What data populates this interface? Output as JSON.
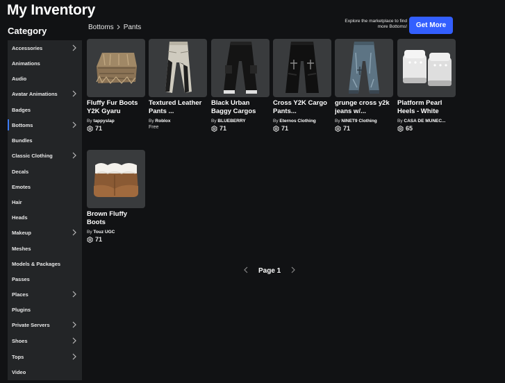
{
  "header": {
    "title": "My Inventory"
  },
  "sidebar": {
    "title": "Category",
    "items": [
      {
        "label": "Accessories",
        "chevron": true
      },
      {
        "label": "Animations",
        "chevron": false
      },
      {
        "label": "Audio",
        "chevron": false
      },
      {
        "label": "Avatar Animations",
        "chevron": true
      },
      {
        "label": "Badges",
        "chevron": false
      },
      {
        "label": "Bottoms",
        "chevron": true,
        "active": true
      },
      {
        "label": "Bundles",
        "chevron": false
      },
      {
        "label": "Classic Clothing",
        "chevron": true
      },
      {
        "label": "Decals",
        "chevron": false
      },
      {
        "label": "Emotes",
        "chevron": false
      },
      {
        "label": "Hair",
        "chevron": false
      },
      {
        "label": "Heads",
        "chevron": false
      },
      {
        "label": "Makeup",
        "chevron": true
      },
      {
        "label": "Meshes",
        "chevron": false
      },
      {
        "label": "Models & Packages",
        "chevron": false
      },
      {
        "label": "Passes",
        "chevron": false
      },
      {
        "label": "Places",
        "chevron": true
      },
      {
        "label": "Plugins",
        "chevron": false
      },
      {
        "label": "Private Servers",
        "chevron": true
      },
      {
        "label": "Shoes",
        "chevron": true
      },
      {
        "label": "Tops",
        "chevron": true
      },
      {
        "label": "Video",
        "chevron": false
      }
    ]
  },
  "breadcrumb": {
    "parent": "Bottoms",
    "current": "Pants"
  },
  "promo": {
    "text": "Explore the marketplace to find more Bottoms!",
    "button_label": "Get More"
  },
  "items": [
    {
      "name": "Fluffy Fur Boots Y2K Gyaru",
      "by": "By",
      "creator": "tappyslap",
      "price": "71",
      "icon": "fur-boots"
    },
    {
      "name": "Textured Leather Pants ...",
      "by": "By",
      "creator": "Roblox",
      "price": "Free",
      "icon": "leather-pants"
    },
    {
      "name": "Black Urban Baggy Cargos",
      "by": "By",
      "creator": "BLUEBERRY",
      "price": "71",
      "icon": "black-cargos"
    },
    {
      "name": "Cross Y2K Cargo Pants...",
      "by": "By",
      "creator": "Eternos Clothing",
      "price": "71",
      "icon": "cross-cargos"
    },
    {
      "name": "grunge cross y2k jeans w/...",
      "by": "By",
      "creator": "NINET9 Clothing",
      "price": "71",
      "icon": "grunge-jeans"
    },
    {
      "name": "Platform Pearl Heels - White",
      "by": "By",
      "creator": "CASA DE MUNEC...",
      "price": "65",
      "icon": "pearl-heels"
    },
    {
      "name": "Brown Fluffy Boots",
      "by": "By",
      "creator": "Touz UGC",
      "price": "71",
      "icon": "brown-boots"
    }
  ],
  "pagination": {
    "label": "Page 1"
  },
  "colors": {
    "accent": "#335fff",
    "active_indicator": "#3d7cf5",
    "card_bg": "#393b3d",
    "sidebar_bg": "#232527",
    "page_bg": "#111214"
  }
}
